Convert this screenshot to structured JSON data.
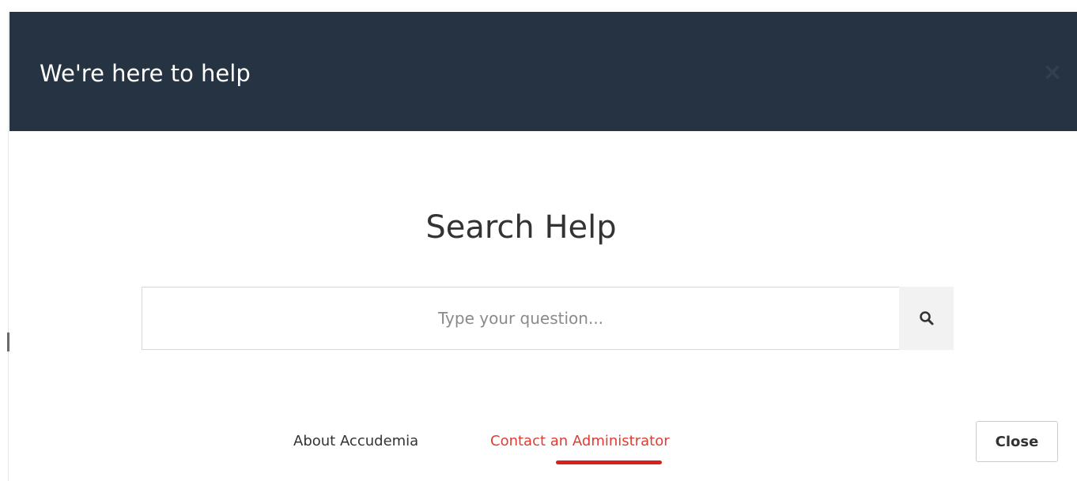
{
  "modal": {
    "title": "We're here to help",
    "close_glyph": "×"
  },
  "search": {
    "heading": "Search Help",
    "placeholder": "Type your question...",
    "button_icon": "search-icon"
  },
  "footer": {
    "about_link": "About Accudemia",
    "contact_link": "Contact an Administrator",
    "close_label": "Close"
  },
  "colors": {
    "header_bg": "#263342",
    "header_text": "#ffffff",
    "contact_link": "#e03c31",
    "annotation_underline": "#d9201d"
  }
}
